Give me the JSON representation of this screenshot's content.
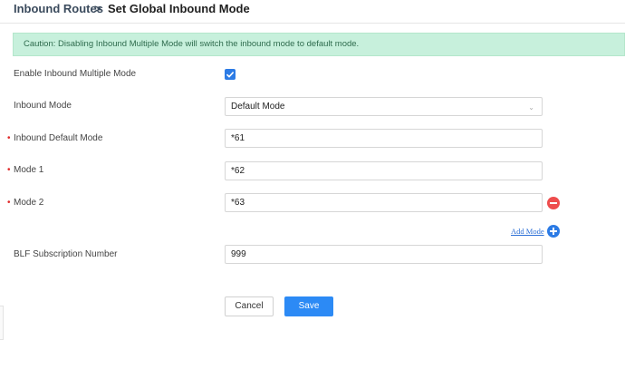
{
  "breadcrumb": {
    "parent": "Inbound Routes",
    "separator": ">",
    "current": "Set Global Inbound Mode"
  },
  "caution": {
    "text": "Caution: Disabling Inbound Multiple Mode will switch the inbound mode to default mode."
  },
  "form": {
    "enable_multiple_mode": {
      "label": "Enable Inbound Multiple Mode",
      "checked": true
    },
    "inbound_mode": {
      "label": "Inbound Mode",
      "value": "Default Mode"
    },
    "inbound_default_mode": {
      "label": "Inbound Default Mode",
      "required_mark": "•",
      "value": "*61"
    },
    "mode_1": {
      "label": "Mode 1",
      "required_mark": "•",
      "value": "*62"
    },
    "mode_2": {
      "label": "Mode 2",
      "required_mark": "•",
      "value": "*63"
    },
    "add_mode_label": "Add Mode",
    "blf_subscription_number": {
      "label": "BLF Subscription Number",
      "value": "999"
    }
  },
  "buttons": {
    "cancel": "Cancel",
    "save": "Save"
  },
  "colors": {
    "accent": "#2c8af5",
    "caution_bg": "#c7f0dc",
    "remove": "#ee4d4d"
  }
}
